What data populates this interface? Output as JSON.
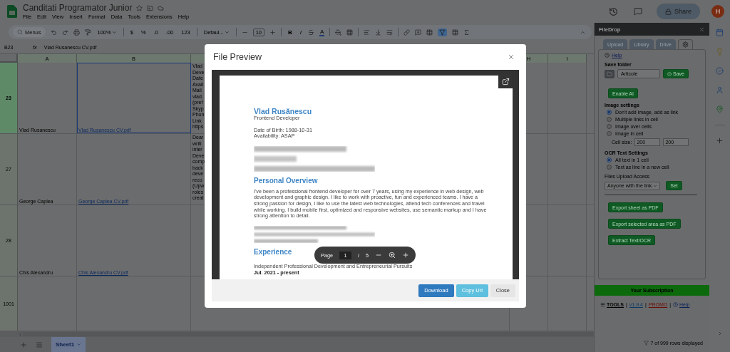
{
  "app": {
    "title": "Canditati Programator Junior",
    "menus": [
      "File",
      "Edit",
      "View",
      "Insert",
      "Format",
      "Data",
      "Tools",
      "Extensions",
      "Help"
    ],
    "share": "Share",
    "avatar": "H"
  },
  "toolbar": {
    "search_placeholder": "Menus",
    "zoom": "100%",
    "number_formats": [
      "$",
      "%",
      ".0",
      ".00",
      "123"
    ],
    "font": "Defaul...",
    "font_size": "10",
    "styles": [
      {
        "kind": "bold",
        "label": "B"
      },
      {
        "kind": "italic",
        "label": "I"
      },
      {
        "kind": "strike"
      },
      {
        "kind": "color",
        "label": "A"
      }
    ],
    "filter_active": true
  },
  "formula_bar": {
    "cell": "B23",
    "fx": "fx",
    "formula": "Vlad Rusanescu CV.pdf"
  },
  "sheet": {
    "columns": [
      {
        "kind": "labeled",
        "label": "A"
      },
      {
        "kind": "labeled",
        "label": "B"
      },
      {
        "kind": "covered"
      },
      {
        "kind": "labeled",
        "label": "H"
      },
      {
        "kind": "labeled",
        "label": "I"
      }
    ],
    "rows": [
      {
        "number": "23",
        "selected": true,
        "name": "Vlad Rusanescu",
        "file": "Vlad Rusanescu CV.pdf",
        "notes": [
          "Vlad",
          "Deve",
          "Date",
          "Avail",
          "Mail",
          "vlad.",
          "(pref",
          "Skyp",
          "Phon",
          "Link",
          "https"
        ]
      },
      {
        "number": "27",
        "selected": false,
        "name": "George Caplea",
        "file": "George Caplea CV.pdf",
        "notes": [
          "Dear",
          "writi",
          "inter",
          "Deve",
          "comp",
          "back",
          "deve",
          "reco",
          "(Upw",
          "roles",
          "creat"
        ]
      },
      {
        "number": "28",
        "selected": false,
        "name": "Chis Alexandru",
        "file": "Chis Alexandru CV.pdf"
      },
      {
        "number": "1001",
        "selected": false
      }
    ],
    "tabs": [
      {
        "label": "Sheet1",
        "selected": true
      }
    ]
  },
  "panel": {
    "title": "FileDrop",
    "tabs": [
      {
        "kind": "text",
        "label": "Upload",
        "selected": false
      },
      {
        "kind": "text",
        "label": "Library",
        "selected": false
      },
      {
        "kind": "text",
        "label": "Drive",
        "selected": false
      },
      {
        "kind": "settings",
        "selected": true
      }
    ],
    "help": "Help",
    "save_folder_label": "Save folder",
    "folder_value": "Articole",
    "save": "Save",
    "enable_ai": "Enable AI",
    "image_settings_label": "Image settings",
    "image_options": [
      {
        "label": "Don't add image, add as link",
        "selected": true
      },
      {
        "label": "Multiple links in cell",
        "selected": false
      },
      {
        "label": "Image over cells",
        "selected": false
      },
      {
        "label": "Image in cell",
        "selected": false
      }
    ],
    "cell_size_label": "Cell size:",
    "cell_size": [
      "200",
      "200"
    ],
    "ocr_label": "OCR Text Settings",
    "ocr_options": [
      {
        "label": "All text in 1 cell",
        "selected": true
      },
      {
        "label": "Text as line in a new cell",
        "selected": false
      }
    ],
    "access_label": "Files Upload Access",
    "access_value": "Anyone with the link",
    "set": "Set",
    "actions": [
      "Export sheet as PDF",
      "Export selected area as PDF",
      "Extract Text/OCR"
    ],
    "subscription": "Your Subscription",
    "footer_separator": "|",
    "footer": [
      {
        "kind": "menu",
        "label": "TOOLS"
      },
      {
        "kind": "version",
        "label": "v1.9.4"
      },
      {
        "kind": "promo",
        "label": "PROMO"
      },
      {
        "kind": "help",
        "label": "Help"
      }
    ],
    "status": "7 of 999 rows displayed"
  },
  "modal": {
    "title": "File Preview",
    "document": [
      {
        "kind": "name",
        "text": "Vlad Rusănescu"
      },
      {
        "kind": "line",
        "text": "Frontend Developer"
      },
      {
        "kind": "detail",
        "text": "Date of Birth: 1988-10-31"
      },
      {
        "kind": "line",
        "text": "Availability: ASAP"
      },
      {
        "kind": "redacted"
      },
      {
        "kind": "heading",
        "text": "Personal Overview"
      },
      {
        "kind": "paragraph",
        "text": "I've been a professional frontend developer for over 7 years, using my experience in web design, web development and graphic design. I like to work with proactive, fun and experienced teams. I have a strong passion for design, I like to use the latest web technologies, attend tech conferences and travel while working. I build mobile first, optimized and responsive websites, use semantic markup and I have strong attention to detail."
      },
      {
        "kind": "redacted"
      },
      {
        "kind": "heading",
        "text": "Experience"
      },
      {
        "kind": "detail",
        "text": "Independent Professional Development and Entrepreneurial Pursuits"
      },
      {
        "kind": "bold",
        "text": "Jul. 2021 - present"
      }
    ],
    "pager": {
      "label": "Page",
      "page": "1",
      "separator": "/",
      "total": "5"
    },
    "buttons": [
      {
        "kind": "primary",
        "label": "Download"
      },
      {
        "kind": "info",
        "label": "Copy Url"
      },
      {
        "kind": "plain",
        "label": "Close"
      }
    ]
  }
}
